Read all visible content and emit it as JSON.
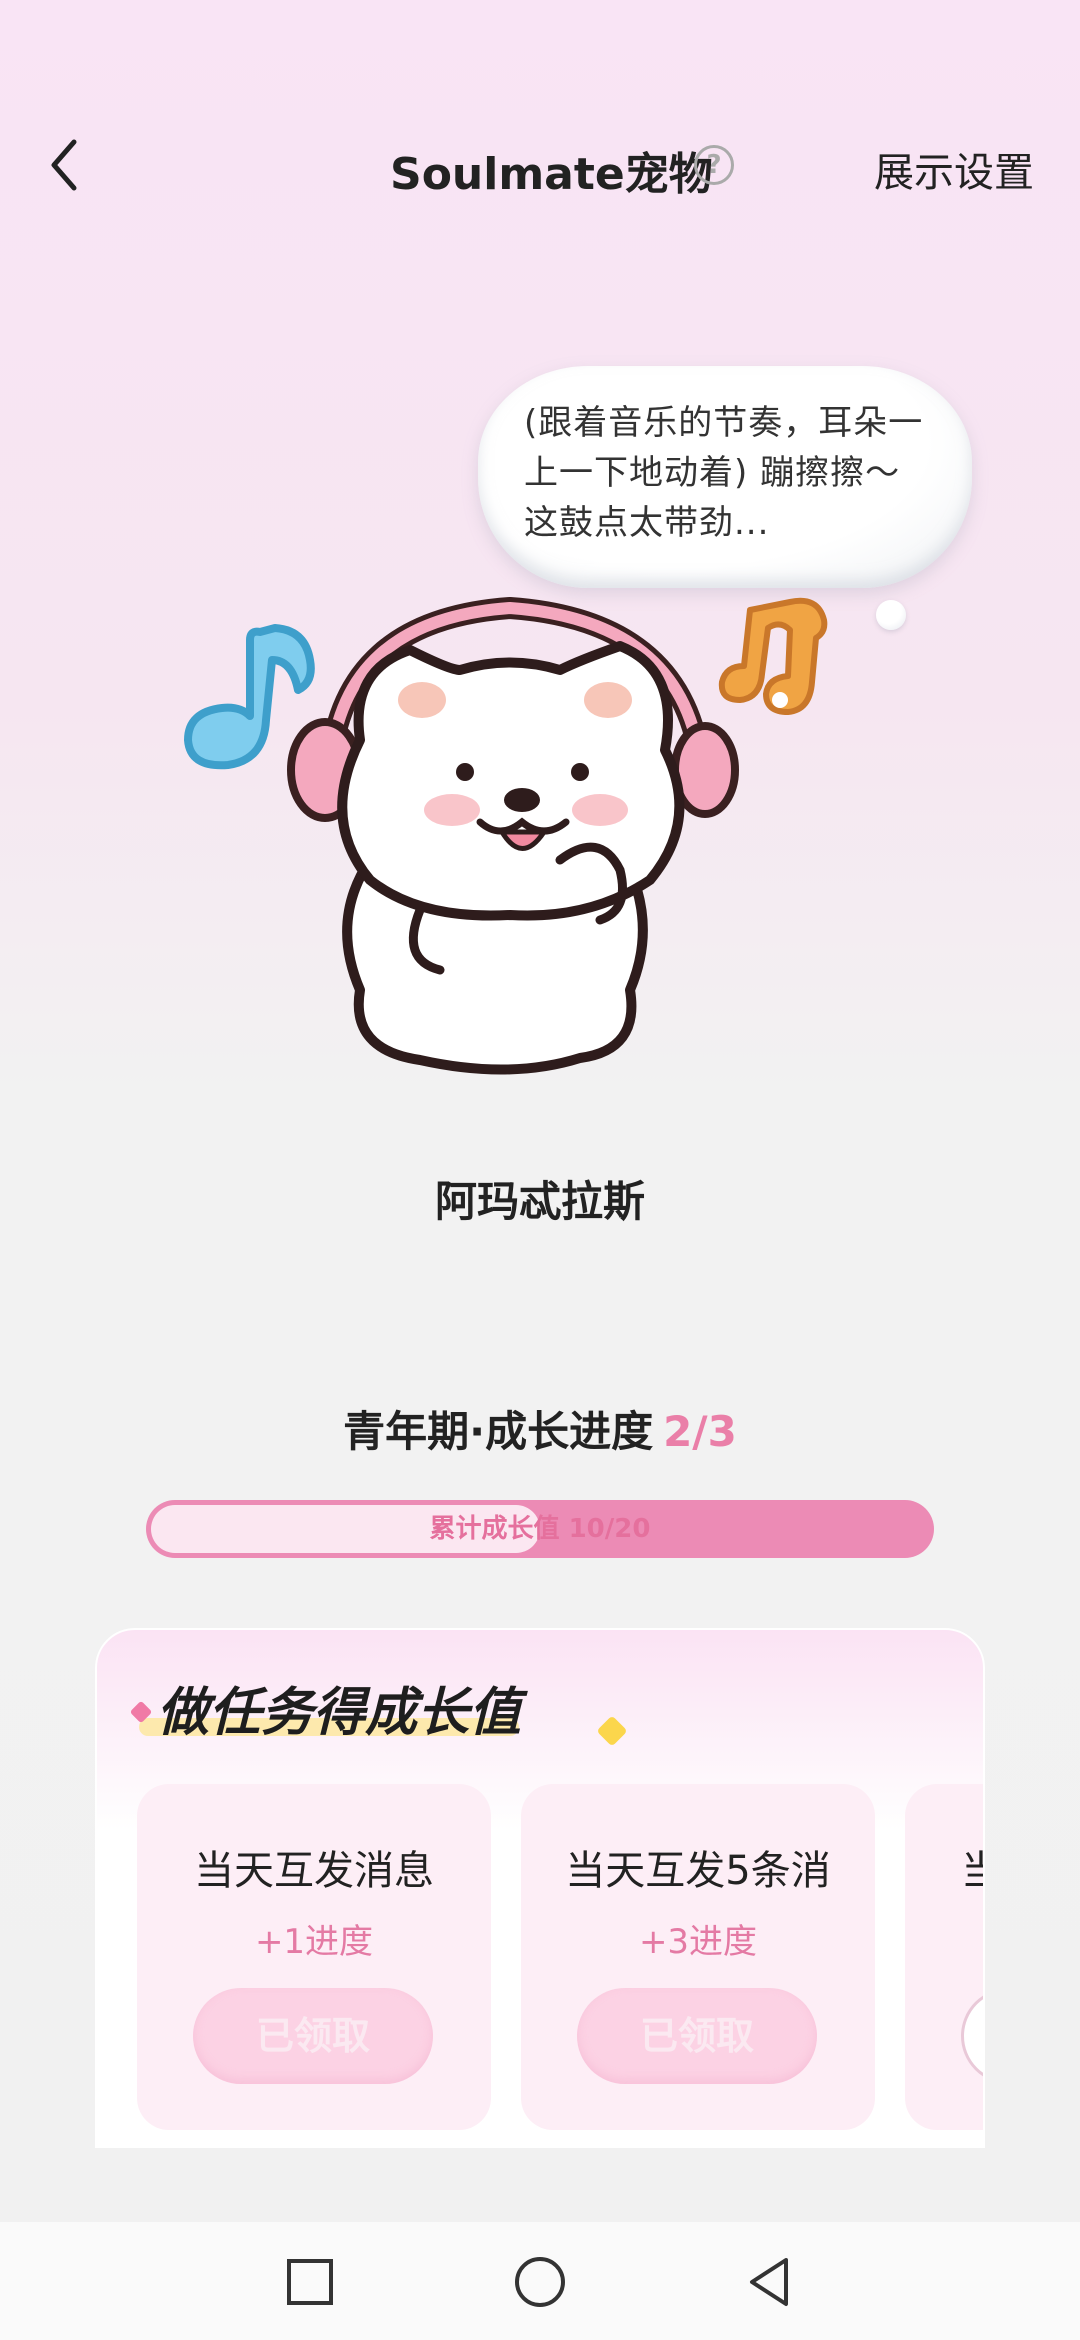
{
  "header": {
    "title": "Soulmate宠物",
    "help_icon": "question-circle-icon",
    "right_action": "展示设置"
  },
  "pet": {
    "speech": "(跟着音乐的节奏，耳朵一上一下地动着) 蹦擦擦～这鼓点太带劲...",
    "name": "阿玛忒拉斯"
  },
  "growth": {
    "stage_label": "青年期·成长进度",
    "stage_progress": "2/3",
    "bar_label": "累计成长值 10/20",
    "bar_value": 10,
    "bar_max": 20
  },
  "tasks": {
    "title": "做任务得成长值",
    "items": [
      {
        "title": "当天互发消息",
        "reward": "+1进度",
        "button": "已领取"
      },
      {
        "title": "当天互发5条消",
        "reward": "+3进度",
        "button": "已领取"
      },
      {
        "title": "当"
      }
    ]
  },
  "colors": {
    "accent_pink": "#ea7fa8",
    "bar_pink": "#ec8bb5"
  },
  "navbar": {
    "icons": [
      "square-icon",
      "circle-icon",
      "triangle-back-icon"
    ]
  }
}
